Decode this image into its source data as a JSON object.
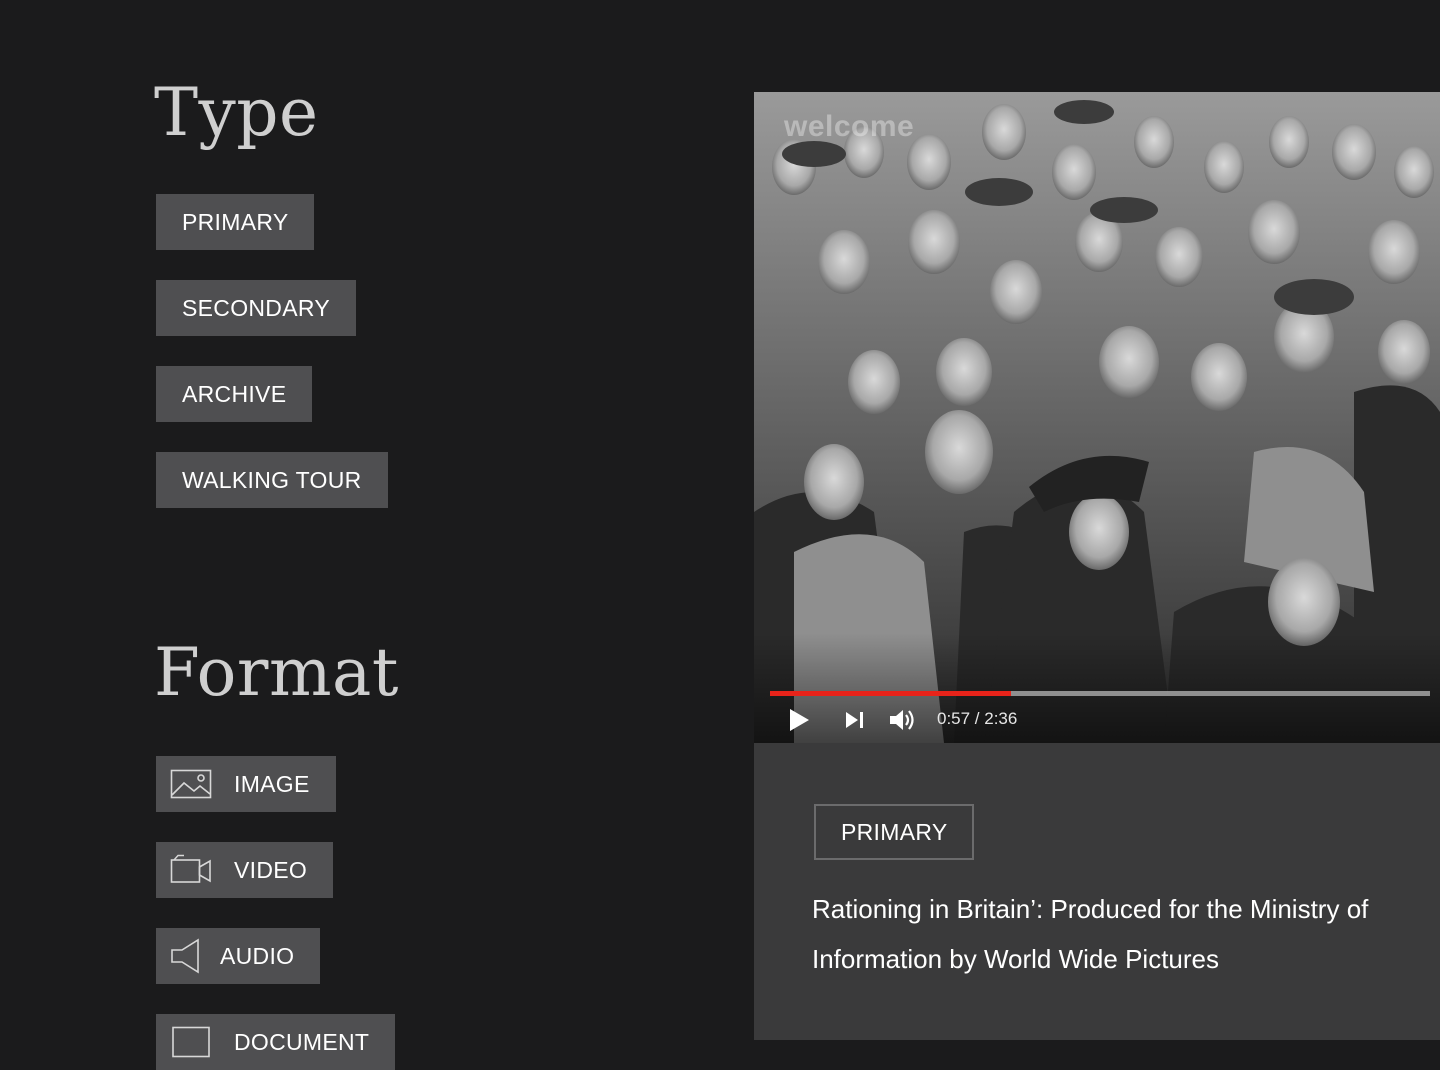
{
  "type_section": {
    "title": "Type",
    "filters": [
      "PRIMARY",
      "SECONDARY",
      "ARCHIVE",
      "WALKING TOUR"
    ]
  },
  "format_section": {
    "title": "Format",
    "filters": [
      {
        "label": "IMAGE",
        "icon": "image-icon"
      },
      {
        "label": "VIDEO",
        "icon": "video-camera-icon"
      },
      {
        "label": "AUDIO",
        "icon": "speaker-icon"
      },
      {
        "label": "DOCUMENT",
        "icon": "document-icon"
      }
    ]
  },
  "media_card": {
    "video": {
      "watermark": "welcome",
      "current_time": "0:57",
      "duration": "2:36",
      "time_display": "0:57 / 2:36",
      "progress_fraction": 0.365
    },
    "badge": "PRIMARY",
    "title": "Rationing in Britain’: Produced for the Ministry of Information by World Wide Pictures"
  },
  "colors": {
    "page_background": "#1b1b1c",
    "button_background": "#4f4f51",
    "card_background": "#3a3a3b",
    "progress_accent": "#e8231a",
    "heading_text": "#cfcfcf"
  }
}
